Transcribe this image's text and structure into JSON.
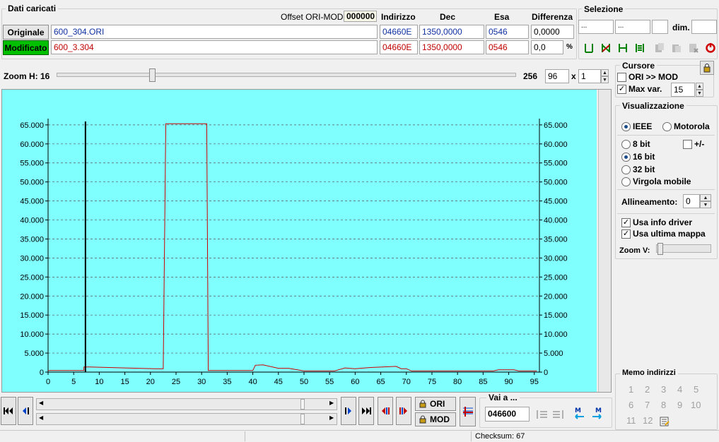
{
  "loaded": {
    "section_title": "Dati caricati",
    "offset_label": "Offset ORI-MOD",
    "offset_value": "000000",
    "headers": {
      "indirizzo": "Indirizzo",
      "dec": "Dec",
      "esa": "Esa",
      "differenza": "Differenza"
    },
    "original": {
      "button": "Originale",
      "file": "600_304.ORI",
      "indirizzo": "04660E",
      "dec": "1350,0000",
      "esa": "0546",
      "diff": "0,0000"
    },
    "modified": {
      "button": "Modificato",
      "file": "600_3.304",
      "indirizzo": "04660E",
      "dec": "1350,0000",
      "esa": "0546",
      "diff": "0,0",
      "pct": "%"
    }
  },
  "selection": {
    "title": "Selezione",
    "field1": "...",
    "field2": "...",
    "dim_label": "dim."
  },
  "zoom_h": {
    "label": "Zoom H: 16",
    "level": 0.207,
    "max": "256",
    "value": "96",
    "x_label": "x",
    "mult": "1"
  },
  "cursor": {
    "title": "Cursore",
    "ori_mod": "ORI >> MOD",
    "max_var": "Max var.",
    "max_var_value": "15"
  },
  "view": {
    "title": "Visualizzazione",
    "ieee": "IEEE",
    "motorola": "Motorola",
    "bit8": "8 bit",
    "plusminus": "+/-",
    "bit16": "16 bit",
    "bit32": "32 bit",
    "float": "Virgola mobile",
    "align_label": "Allineamento:",
    "align_value": "0",
    "usa_driver": "Usa info driver",
    "usa_mappa": "Usa ultima mappa",
    "zoom_v": "Zoom V:"
  },
  "memo": {
    "title": "Memo indirizzi",
    "items": [
      "1",
      "2",
      "3",
      "4",
      "5",
      "6",
      "7",
      "8",
      "9",
      "10",
      "11",
      "12"
    ]
  },
  "nav": {
    "ori": "ORI",
    "mod": "MOD",
    "goto_title": "Vai a ...",
    "goto_value": "046600"
  },
  "status": {
    "checksum": "Checksum: 67"
  },
  "colors": {
    "plot_bg": "#80ffff",
    "series": "#cc0000",
    "accent_green": "#00c000"
  },
  "chart_data": {
    "type": "line",
    "xlim": [
      0,
      96
    ],
    "ylim": [
      0,
      65535
    ],
    "x_ticks": [
      "0",
      "5",
      "10",
      "15",
      "20",
      "25",
      "30",
      "35",
      "40",
      "45",
      "50",
      "55",
      "60",
      "65",
      "70",
      "75",
      "80",
      "85",
      "90",
      "95"
    ],
    "y_ticks": [
      "0",
      "5.000",
      "10.000",
      "15.000",
      "20.000",
      "25.000",
      "30.000",
      "35.000",
      "40.000",
      "45.000",
      "50.000",
      "55.000",
      "60.000",
      "65.000"
    ],
    "grid": true,
    "cursor_x": 7.3,
    "series": [
      {
        "x": [
          0,
          7,
          7,
          8,
          15,
          21,
          22.5,
          23,
          31,
          31.3,
          32,
          40,
          40.5,
          42,
          45,
          47,
          50,
          56,
          57,
          58,
          60,
          63,
          68,
          69,
          70,
          71,
          87,
          88,
          91,
          92,
          95.5
        ],
        "y": [
          400,
          400,
          1350,
          1350,
          1100,
          900,
          900,
          65300,
          65300,
          400,
          400,
          400,
          1800,
          1900,
          1000,
          1000,
          300,
          300,
          700,
          1100,
          900,
          1200,
          1500,
          900,
          900,
          300,
          300,
          600,
          600,
          300,
          300
        ]
      }
    ]
  }
}
